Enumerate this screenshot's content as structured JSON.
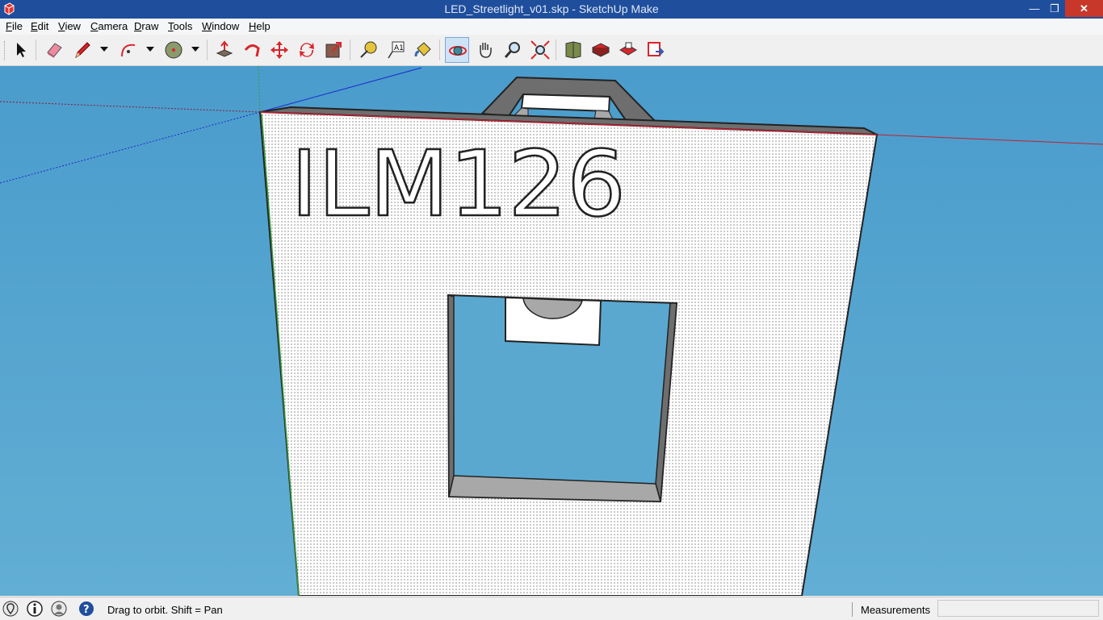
{
  "window": {
    "title": "LED_Streetlight_v01.skp - SketchUp Make",
    "minimize_glyph": "—",
    "maximize_glyph": "❐",
    "close_glyph": "✕"
  },
  "menu": {
    "items": [
      {
        "first": "F",
        "rest": "ile"
      },
      {
        "first": "E",
        "rest": "dit"
      },
      {
        "first": "V",
        "rest": "iew"
      },
      {
        "first": "C",
        "rest": "amera"
      },
      {
        "first": "D",
        "rest": "raw"
      },
      {
        "first": "T",
        "rest": "ools"
      },
      {
        "first": "W",
        "rest": "indow"
      },
      {
        "first": "H",
        "rest": "elp"
      }
    ]
  },
  "toolbar": {
    "tools": [
      "select-icon",
      "eraser-icon",
      "pencil-icon",
      "arc-icon",
      "circle-icon",
      "push-pull-icon",
      "follow-me-icon",
      "move-icon",
      "rotate-icon",
      "scale-icon",
      "tape-measure-icon",
      "text-icon",
      "paint-bucket-icon",
      "orbit-icon",
      "pan-icon",
      "zoom-icon",
      "zoom-extents-icon",
      "3d-warehouse-icon",
      "extension-warehouse-icon",
      "layout-icon",
      "send-to-layout-icon"
    ],
    "active": "orbit-icon",
    "colors": {
      "accent_red": "#d9262c",
      "accent_green": "#3a8a3a",
      "highlight": "#cfe3f7"
    }
  },
  "viewport": {
    "model_text": "ILM126",
    "colors": {
      "sky": "#4a9ccc",
      "face": "#ffffff",
      "edge": "#222222",
      "inner_face": "#a8a8a8",
      "dark_face": "#6e6e6e"
    }
  },
  "statusbar": {
    "hint": "Drag to orbit.  Shift = Pan",
    "measurements_label": "Measurements",
    "measurements_value": ""
  }
}
